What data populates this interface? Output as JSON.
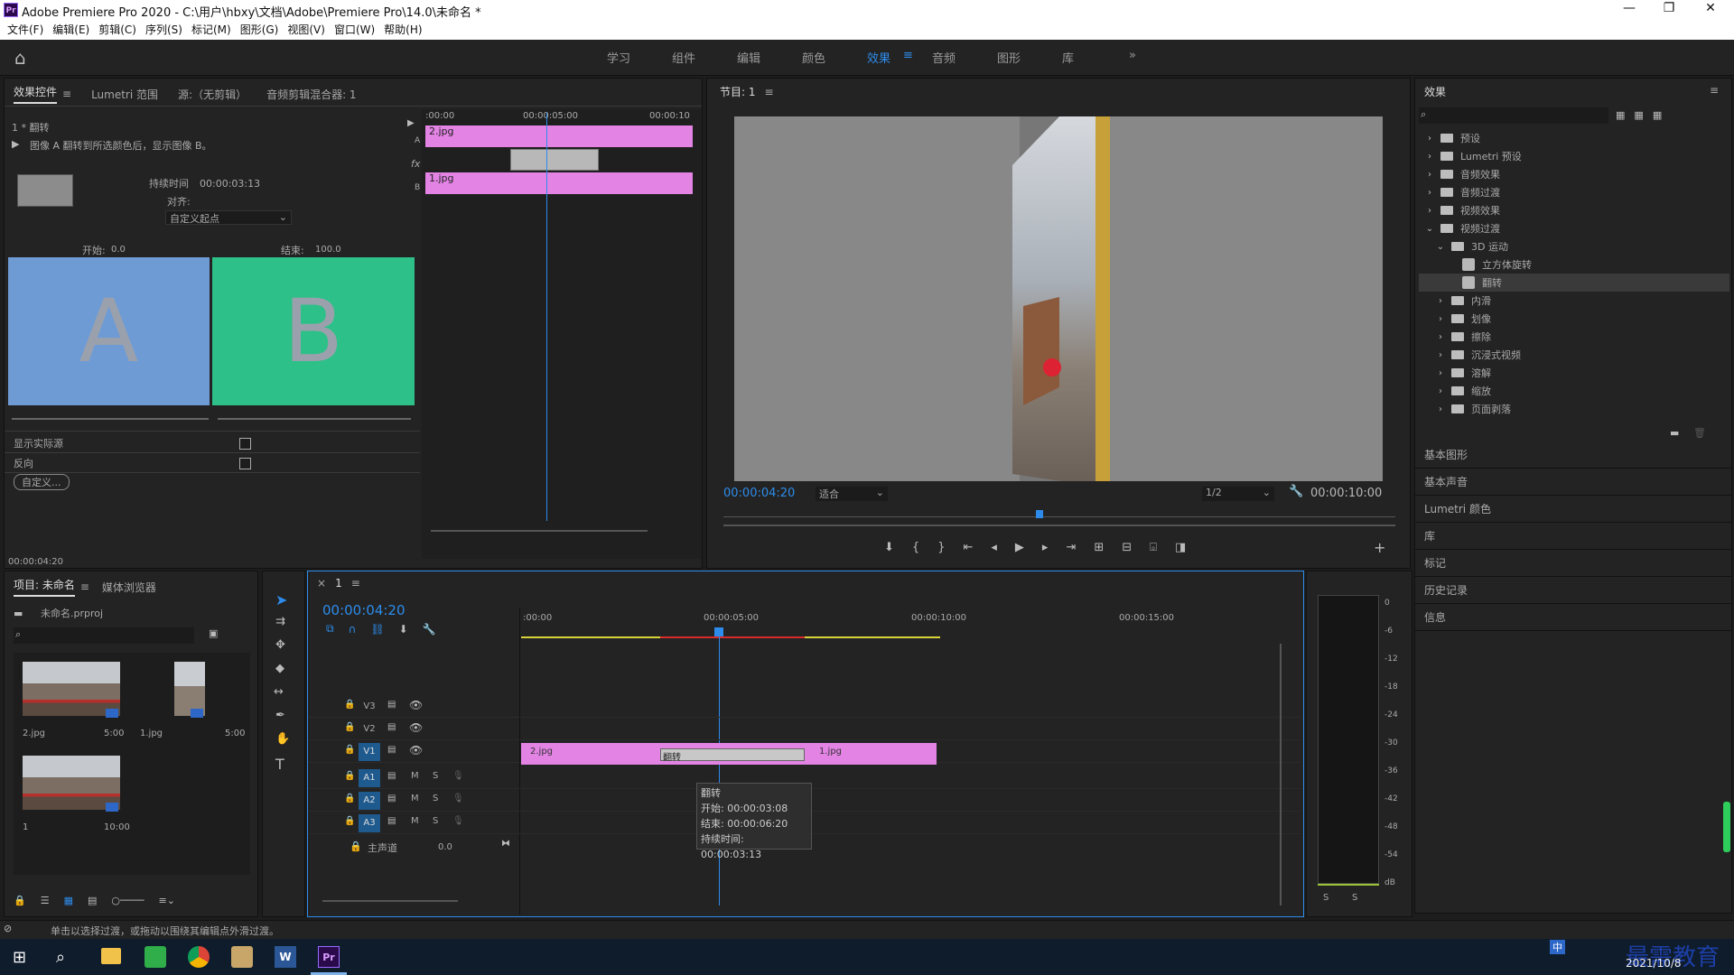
{
  "window": {
    "title": "Adobe Premiere Pro 2020 - C:\\用户\\hbxy\\文档\\Adobe\\Premiere Pro\\14.0\\未命名 *",
    "app_logo": "Pr"
  },
  "menu": [
    "文件(F)",
    "编辑(E)",
    "剪辑(C)",
    "序列(S)",
    "标记(M)",
    "图形(G)",
    "视图(V)",
    "窗口(W)",
    "帮助(H)"
  ],
  "workspaces": [
    "学习",
    "组件",
    "编辑",
    "颜色",
    "效果",
    "音频",
    "图形",
    "库"
  ],
  "active_workspace": "效果",
  "effect_controls": {
    "tabs": [
      "效果控件",
      "Lumetri 范围",
      "源:（无剪辑）",
      "音频剪辑混合器: 1"
    ],
    "sequence_label": "1 * 翻转",
    "description": "图像 A 翻转到所选颜色后，显示图像 B。",
    "duration_label": "持续时间",
    "duration_value": "00:00:03:13",
    "align_label": "对齐:",
    "align_value": "自定义起点",
    "start_label": "开始:",
    "start_value": "0.0",
    "end_label": "结束:",
    "end_value": "100.0",
    "preview_a": "A",
    "preview_b": "B",
    "color_a": "#6f9bd4",
    "color_b": "#2dc088",
    "show_source_label": "显示实际源",
    "reverse_label": "反向",
    "custom_button": "自定义...",
    "timecode": "00:00:04:20",
    "mini_timeline": {
      "ticks": [
        ":00:00",
        "00:00:05:00",
        "00:00:10"
      ],
      "track_a": "A",
      "track_b": "B",
      "clip_a": "2.jpg",
      "clip_b": "1.jpg",
      "fx": "fx"
    }
  },
  "program_monitor": {
    "tab": "节目: 1",
    "timecode": "00:00:04:20",
    "fit": "适合",
    "quality": "1/2",
    "duration": "00:00:10:00"
  },
  "effects_panel": {
    "title": "效果",
    "search_placeholder": "",
    "tree": [
      {
        "label": "预设",
        "level": 0,
        "type": "folder"
      },
      {
        "label": "Lumetri 预设",
        "level": 0,
        "type": "folder"
      },
      {
        "label": "音频效果",
        "level": 0,
        "type": "folder"
      },
      {
        "label": "音频过渡",
        "level": 0,
        "type": "folder"
      },
      {
        "label": "视频效果",
        "level": 0,
        "type": "folder"
      },
      {
        "label": "视频过渡",
        "level": 0,
        "type": "folder",
        "open": true
      },
      {
        "label": "3D 运动",
        "level": 1,
        "type": "folder",
        "open": true
      },
      {
        "label": "立方体旋转",
        "level": 2,
        "type": "item"
      },
      {
        "label": "翻转",
        "level": 2,
        "type": "item",
        "selected": true
      },
      {
        "label": "内滑",
        "level": 1,
        "type": "folder"
      },
      {
        "label": "划像",
        "level": 1,
        "type": "folder"
      },
      {
        "label": "擦除",
        "level": 1,
        "type": "folder"
      },
      {
        "label": "沉浸式视频",
        "level": 1,
        "type": "folder"
      },
      {
        "label": "溶解",
        "level": 1,
        "type": "folder"
      },
      {
        "label": "缩放",
        "level": 1,
        "type": "folder"
      },
      {
        "label": "页面剥落",
        "level": 1,
        "type": "folder"
      }
    ],
    "sections": [
      "基本图形",
      "基本声音",
      "Lumetri 颜色",
      "库",
      "标记",
      "历史记录",
      "信息"
    ]
  },
  "project_panel": {
    "tabs": [
      "项目: 未命名",
      "媒体浏览器"
    ],
    "file": "未命名.prproj",
    "items": [
      {
        "name": "2.jpg",
        "dur": "5:00"
      },
      {
        "name": "1.jpg",
        "dur": "5:00"
      },
      {
        "name": "1",
        "dur": "10:00"
      }
    ]
  },
  "timeline": {
    "tab": "1",
    "timecode": "00:00:04:20",
    "ruler": [
      ":00:00",
      "00:00:05:00",
      "00:00:10:00",
      "00:00:15:00"
    ],
    "tracks": [
      {
        "id": "V3",
        "kind": "video"
      },
      {
        "id": "V2",
        "kind": "video"
      },
      {
        "id": "V1",
        "kind": "video"
      },
      {
        "id": "A1",
        "kind": "audio"
      },
      {
        "id": "A2",
        "kind": "audio"
      },
      {
        "id": "A3",
        "kind": "audio"
      }
    ],
    "master_label": "主声道",
    "master_value": "0.0",
    "clip_a": "2.jpg",
    "clip_b": "1.jpg",
    "transition": "翻转",
    "tooltip": {
      "name": "翻转",
      "start": "开始: 00:00:03:08",
      "end": "结束: 00:00:06:20",
      "duration": "持续时间: 00:00:03:13"
    },
    "m_label": "M",
    "s_label": "S"
  },
  "meter": {
    "scale": [
      "0",
      "-6",
      "-12",
      "-18",
      "-24",
      "-30",
      "-36",
      "-42",
      "-48",
      "-54",
      "dB"
    ],
    "solo": [
      "S",
      "S"
    ]
  },
  "status": "单击以选择过渡，或拖动以围绕其编辑点外滑过渡。",
  "taskbar": {
    "date": "2021/10/8",
    "watermark": "最需教育",
    "ime": "中"
  }
}
